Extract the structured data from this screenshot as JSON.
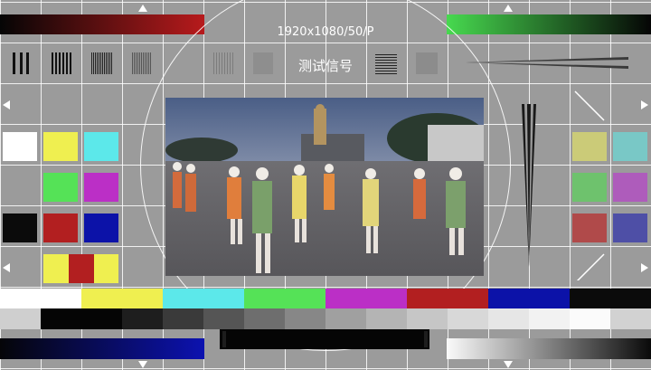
{
  "format_label": "1920x1080/50/P",
  "title_cn": "测试信号",
  "colors": {
    "white": "#ffffff",
    "yellow": "#efef50",
    "cyan": "#5ce8ea",
    "green": "#55e257",
    "magenta": "#bb2fc6",
    "red": "#b21f20",
    "blue": "#0c12a8",
    "black": "#0b0b0b"
  },
  "icons": {
    "triangles": "triangle-marker-icon",
    "circle": "registration-circle"
  }
}
